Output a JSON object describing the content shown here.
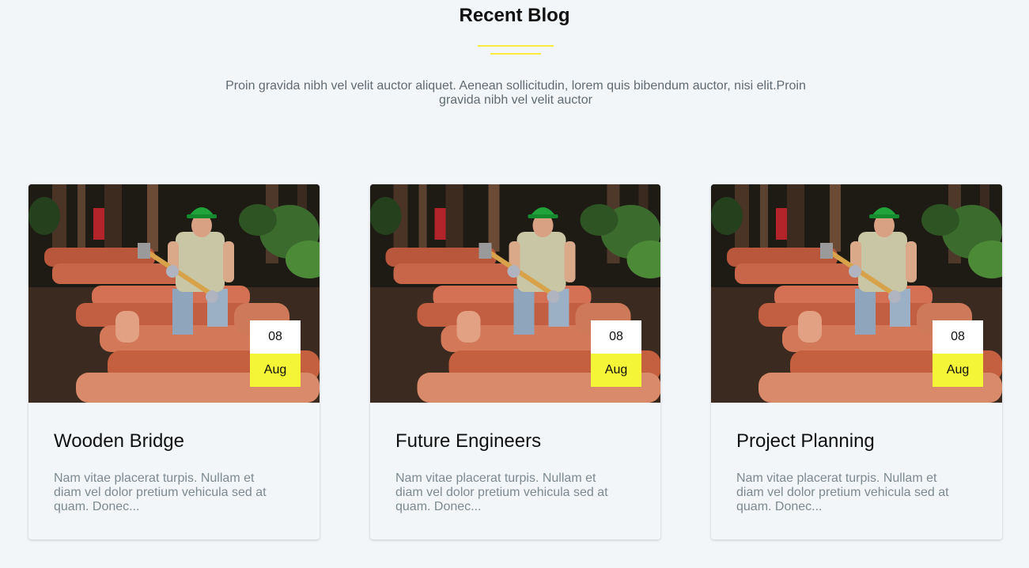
{
  "section": {
    "title": "Recent Blog",
    "description": "Proin gravida nibh vel velit auctor aliquet. Aenean sollicitudin, lorem quis bibendum auctor, nisi elit.Proin gravida nibh vel velit auctor"
  },
  "colors": {
    "accent": "#ffeb3b",
    "date_month_bg": "#f5f537",
    "background": "#f2f6f8"
  },
  "posts": [
    {
      "image": "worker-with-sledgehammer-on-timber-photo",
      "day": "08",
      "month": "Aug",
      "title": "Wooden Bridge",
      "excerpt": "Nam vitae placerat turpis. Nullam et diam vel dolor pretium vehicula sed at quam. Donec..."
    },
    {
      "image": "worker-with-sledgehammer-on-timber-photo",
      "day": "08",
      "month": "Aug",
      "title": "Future Engineers",
      "excerpt": "Nam vitae placerat turpis. Nullam et diam vel dolor pretium vehicula sed at quam. Donec..."
    },
    {
      "image": "worker-with-sledgehammer-on-timber-photo",
      "day": "08",
      "month": "Aug",
      "title": "Project Planning",
      "excerpt": "Nam vitae placerat turpis. Nullam et diam vel dolor pretium vehicula sed at quam. Donec..."
    }
  ]
}
